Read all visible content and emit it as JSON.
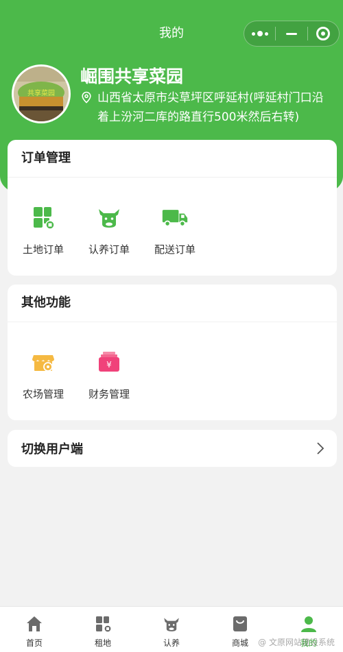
{
  "nav": {
    "title": "我的"
  },
  "profile": {
    "name": "崛围共享菜园",
    "avatar_text": "共享菜园",
    "address": "山西省太原市尖草坪区呼延村(呼延村门口沿着上汾河二库的路直行500米然后右转)"
  },
  "orders": {
    "title": "订单管理",
    "items": [
      {
        "label": "土地订单",
        "icon": "land-icon"
      },
      {
        "label": "认养订单",
        "icon": "cow-icon"
      },
      {
        "label": "配送订单",
        "icon": "truck-icon"
      }
    ]
  },
  "other": {
    "title": "其他功能",
    "items": [
      {
        "label": "农场管理",
        "icon": "shop-icon"
      },
      {
        "label": "财务管理",
        "icon": "finance-icon"
      }
    ]
  },
  "switch_user": {
    "label": "切换用户端"
  },
  "tabbar": {
    "items": [
      {
        "label": "首页",
        "icon": "home-icon"
      },
      {
        "label": "租地",
        "icon": "land-icon"
      },
      {
        "label": "认养",
        "icon": "cow-icon"
      },
      {
        "label": "商城",
        "icon": "bag-icon"
      },
      {
        "label": "我的",
        "icon": "user-icon"
      }
    ],
    "active_index": 4
  },
  "watermark": "@ 文原网站建设系统",
  "colors": {
    "brand_green": "#4cb94a",
    "shop_orange": "#f5b942",
    "finance_pink": "#f0427a"
  }
}
